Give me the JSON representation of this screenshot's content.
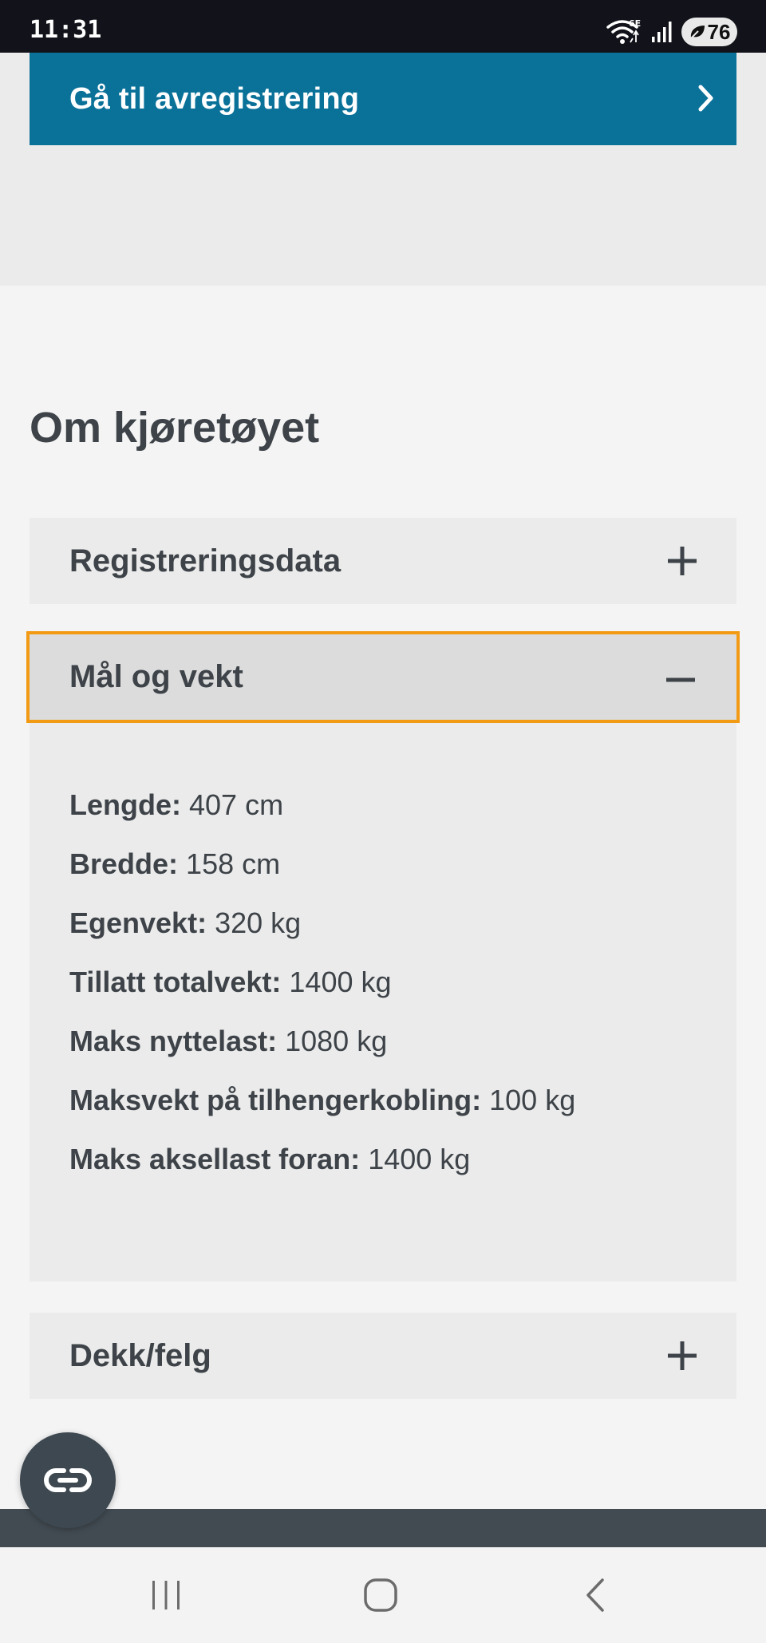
{
  "status_bar": {
    "time": "11:31",
    "network_type": "6E",
    "battery_level": "76",
    "icons": [
      "wifi-icon",
      "signal-icon",
      "battery-saver-icon"
    ]
  },
  "deregister": {
    "label": "Gå til avregistrering",
    "icon": "chevron-right-icon",
    "color": "#0a7199"
  },
  "section": {
    "title": "Om kjøretøyet"
  },
  "accordion": {
    "items": [
      {
        "label": "Registreringsdata",
        "state": "collapsed",
        "icon": "plus-icon"
      },
      {
        "label": "Mål og vekt",
        "state": "expanded",
        "icon": "minus-icon"
      },
      {
        "label": "Dekk/felg",
        "state": "collapsed",
        "icon": "plus-icon"
      }
    ],
    "focus_color": "#f39a14"
  },
  "specs": [
    {
      "key": "Lengde:",
      "value": "407 cm"
    },
    {
      "key": "Bredde:",
      "value": "158 cm"
    },
    {
      "key": "Egenvekt:",
      "value": "320 kg"
    },
    {
      "key": "Tillatt totalvekt:",
      "value": "1400 kg"
    },
    {
      "key": "Maks nyttelast:",
      "value": "1080 kg"
    },
    {
      "key": "Maksvekt på tilhengerkobling:",
      "value": "100 kg"
    },
    {
      "key": "Maks aksellast foran:",
      "value": "1400 kg"
    }
  ],
  "floating_button": {
    "icon": "link-icon"
  },
  "nav_bar": {
    "buttons": [
      "recents-icon",
      "home-icon",
      "back-icon"
    ]
  }
}
